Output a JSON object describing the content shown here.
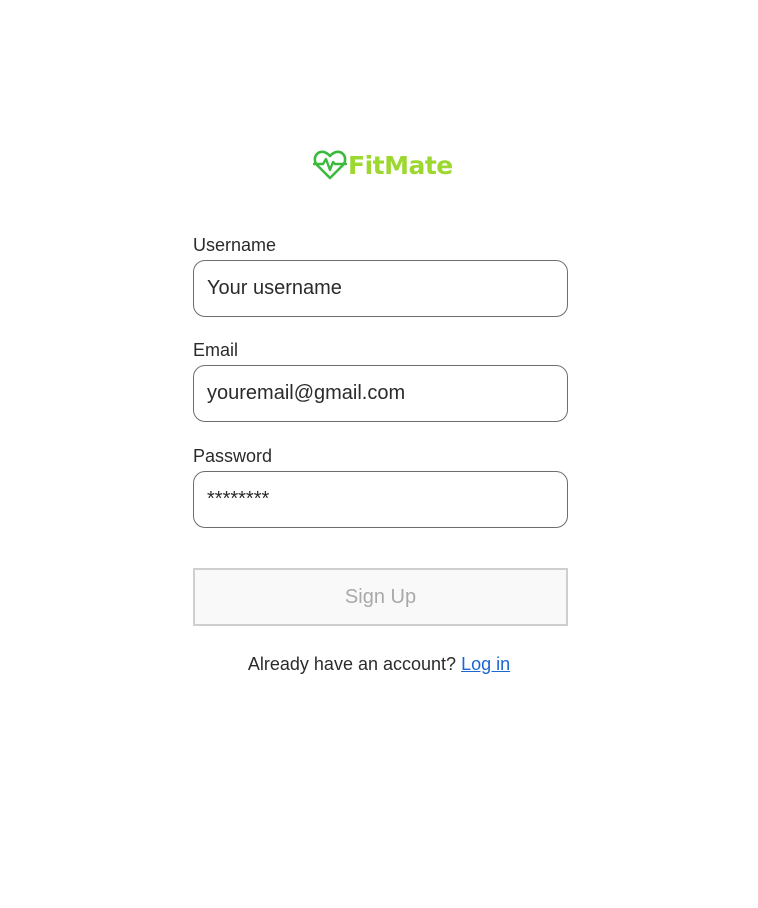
{
  "brand": {
    "name": "FitMate",
    "color": "#9cd82f",
    "icon": "heart-pulse-icon"
  },
  "form": {
    "username": {
      "label": "Username",
      "placeholder": "Your username",
      "value": ""
    },
    "email": {
      "label": "Email",
      "placeholder": "youremail@gmail.com",
      "value": ""
    },
    "password": {
      "label": "Password",
      "placeholder": "********",
      "value": ""
    },
    "submit_label": "Sign Up",
    "submit_disabled": true
  },
  "footer": {
    "prompt": "Already have an account?",
    "login_link": "Log in",
    "link_color": "#1a66d2"
  }
}
